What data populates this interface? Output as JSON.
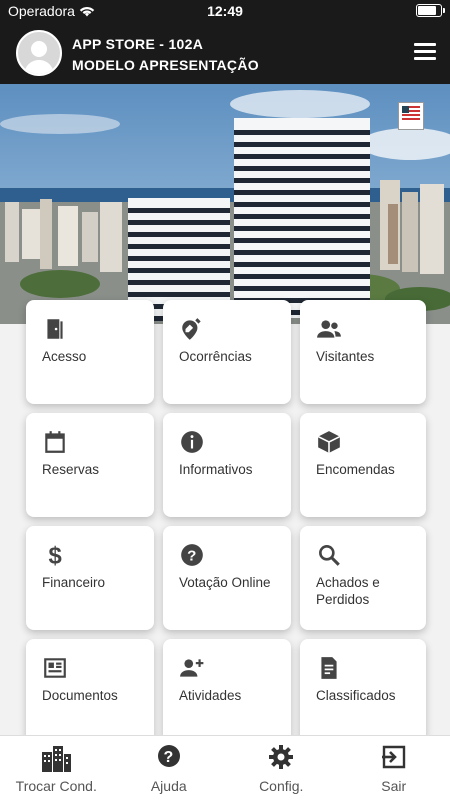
{
  "status_bar": {
    "carrier": "Operadora",
    "time": "12:49",
    "battery_level": 0.9
  },
  "header": {
    "title": "APP STORE - 102A",
    "subtitle": "MODELO APRESENTAÇÃO",
    "menu_icon": "hamburger-icon"
  },
  "hero": {
    "description_icon": "bahia-badge-icon"
  },
  "cards": [
    {
      "label": "Acesso",
      "icon": "door-icon"
    },
    {
      "label": "Ocorrências",
      "icon": "pin-edit-icon"
    },
    {
      "label": "Visitantes",
      "icon": "people-icon"
    },
    {
      "label": "Reservas",
      "icon": "calendar-icon"
    },
    {
      "label": "Informativos",
      "icon": "info-icon"
    },
    {
      "label": "Encomendas",
      "icon": "package-icon"
    },
    {
      "label": "Financeiro",
      "icon": "dollar-icon"
    },
    {
      "label": "Votação Online",
      "icon": "question-icon"
    },
    {
      "label": "Achados e Perdidos",
      "icon": "search-icon"
    },
    {
      "label": "Documentos",
      "icon": "newspaper-icon"
    },
    {
      "label": "Atividades",
      "icon": "person-add-icon"
    },
    {
      "label": "Classificados",
      "icon": "document-icon"
    }
  ],
  "bottom_nav": [
    {
      "label": "Trocar Cond.",
      "icon": "buildings-icon"
    },
    {
      "label": "Ajuda",
      "icon": "help-icon"
    },
    {
      "label": "Config.",
      "icon": "gear-icon"
    },
    {
      "label": "Sair",
      "icon": "logout-icon"
    }
  ],
  "colors": {
    "header_bg": "#1a1a1a",
    "page_bg": "#f2f2f2",
    "icon": "#444444",
    "card_bg": "#ffffff"
  }
}
